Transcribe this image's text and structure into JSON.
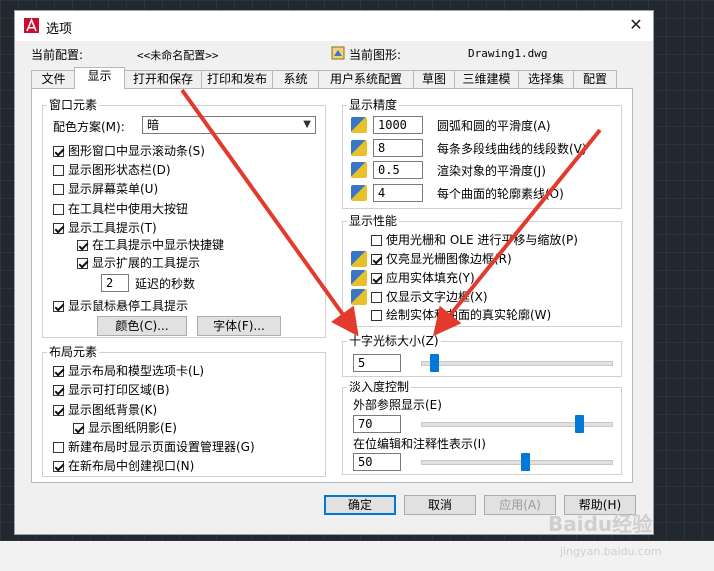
{
  "dialog": {
    "title": "选项"
  },
  "config": {
    "current_profile_label": "当前配置:",
    "current_profile_value": "<<未命名配置>>",
    "current_drawing_label": "当前图形:",
    "current_drawing_value": "Drawing1.dwg"
  },
  "tabs": [
    "文件",
    "显示",
    "打开和保存",
    "打印和发布",
    "系统",
    "用户系统配置",
    "草图",
    "三维建模",
    "选择集",
    "配置"
  ],
  "active_tab": "显示",
  "window_elements": {
    "title": "窗口元素",
    "color_scheme_label": "配色方案(M):",
    "color_scheme_value": "暗",
    "checkboxes": [
      {
        "label": "图形窗口中显示滚动条(S)",
        "checked": true
      },
      {
        "label": "显示图形状态栏(D)",
        "checked": false
      },
      {
        "label": "显示屏幕菜单(U)",
        "checked": false
      },
      {
        "label": "在工具栏中使用大按钮",
        "checked": false
      },
      {
        "label": "显示工具提示(T)",
        "checked": true
      },
      {
        "label": "在工具提示中显示快捷键",
        "checked": true
      },
      {
        "label": "显示扩展的工具提示",
        "checked": true
      }
    ],
    "delay_value": "2",
    "delay_label": "延迟的秒数",
    "rollover_label": "显示鼠标悬停工具提示",
    "rollover_checked": true,
    "colors_button": "颜色(C)...",
    "fonts_button": "字体(F)..."
  },
  "layout_elements": {
    "title": "布局元素",
    "checkboxes": [
      {
        "label": "显示布局和模型选项卡(L)",
        "checked": true
      },
      {
        "label": "显示可打印区域(B)",
        "checked": true
      },
      {
        "label": "显示图纸背景(K)",
        "checked": true
      },
      {
        "label": "显示图纸阴影(E)",
        "checked": true
      },
      {
        "label": "新建布局时显示页面设置管理器(G)",
        "checked": false
      },
      {
        "label": "在新布局中创建视口(N)",
        "checked": true
      }
    ]
  },
  "display_resolution": {
    "title": "显示精度",
    "rows": [
      {
        "value": "1000",
        "label": "圆弧和圆的平滑度(A)"
      },
      {
        "value": "8",
        "label": "每条多段线曲线的线段数(V)"
      },
      {
        "value": "0.5",
        "label": "渲染对象的平滑度(J)"
      },
      {
        "value": "4",
        "label": "每个曲面的轮廓素线(O)"
      }
    ]
  },
  "display_performance": {
    "title": "显示性能",
    "checkboxes": [
      {
        "label": "使用光栅和 OLE 进行平移与缩放(P)",
        "checked": false
      },
      {
        "label": "仅亮显光栅图像边框(R)",
        "checked": true
      },
      {
        "label": "应用实体填充(Y)",
        "checked": true
      },
      {
        "label": "仅显示文字边框(X)",
        "checked": false
      },
      {
        "label": "绘制实体和曲面的真实轮廓(W)",
        "checked": false
      }
    ]
  },
  "crosshair": {
    "title": "十字光标大小(Z)",
    "value": "5",
    "fraction": 0.05
  },
  "fade_control": {
    "title": "淡入度控制",
    "xref_label": "外部参照显示(E)",
    "xref_value": "70",
    "xref_fraction": 0.85,
    "inplace_label": "在位编辑和注释性表示(I)",
    "inplace_value": "50",
    "inplace_fraction": 0.55
  },
  "buttons": {
    "ok": "确定",
    "cancel": "取消",
    "apply": "应用(A)",
    "help": "帮助(H)"
  },
  "watermark": {
    "brand": "Baidu经验",
    "url": "jingyan.baidu.com"
  },
  "colors": {
    "accent": "#0078d7",
    "arrow": "#e23b2e",
    "cad_bg": "#212830"
  },
  "icons": [
    "autocad-app-icon",
    "close-icon",
    "drawing-icon",
    "chevron-down-icon",
    "display-resolution-icon"
  ]
}
